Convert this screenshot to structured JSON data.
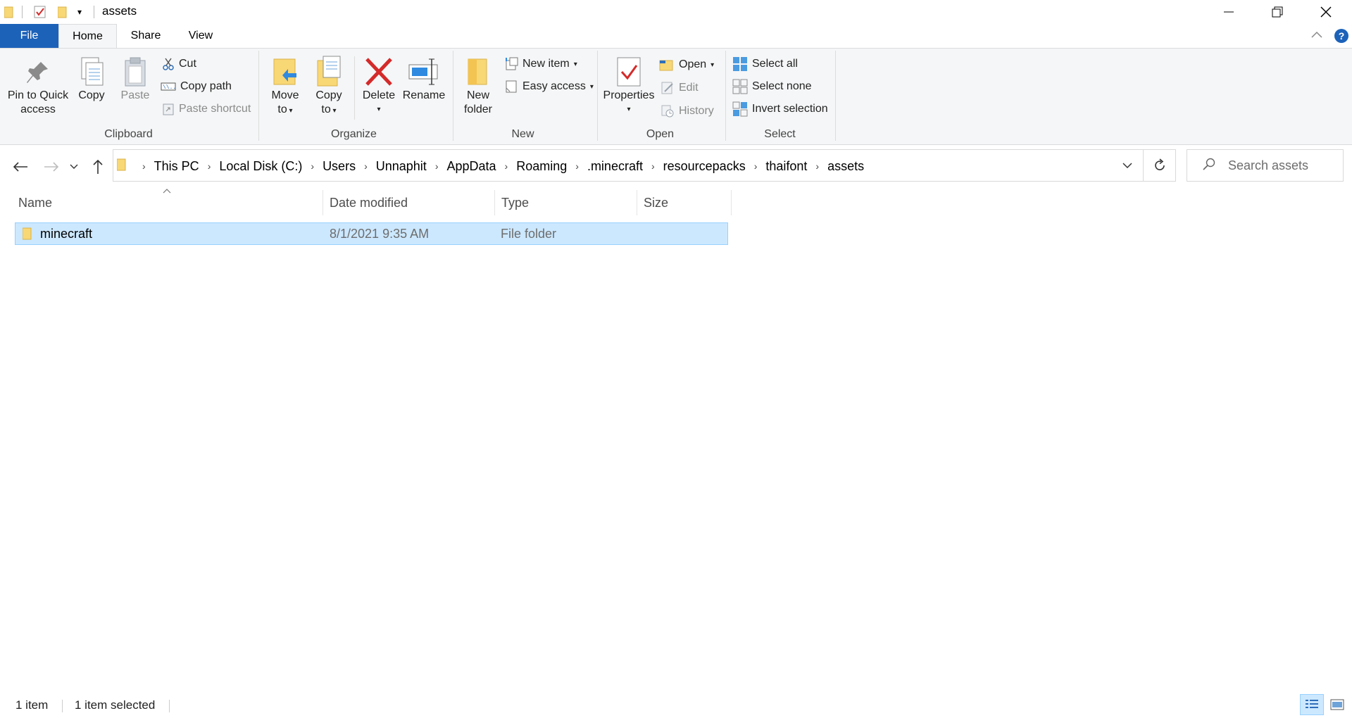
{
  "window": {
    "title": "assets",
    "controls": {
      "minimize": "minimize-icon",
      "restore": "restore-icon",
      "close": "close-icon"
    }
  },
  "ribbon_tabs": [
    "File",
    "Home",
    "Share",
    "View"
  ],
  "ribbon": {
    "clipboard": {
      "label": "Clipboard",
      "pin": "Pin to Quick access",
      "pin_line1": "Pin to Quick",
      "pin_line2": "access",
      "copy": "Copy",
      "paste": "Paste",
      "cut": "Cut",
      "copy_path": "Copy path",
      "paste_shortcut": "Paste shortcut"
    },
    "organize": {
      "label": "Organize",
      "move_to_1": "Move",
      "move_to_2": "to",
      "copy_to_1": "Copy",
      "copy_to_2": "to",
      "delete": "Delete",
      "rename": "Rename"
    },
    "new": {
      "label": "New",
      "new_folder_1": "New",
      "new_folder_2": "folder",
      "new_item": "New item",
      "easy_access": "Easy access"
    },
    "open": {
      "label": "Open",
      "properties": "Properties",
      "open": "Open",
      "edit": "Edit",
      "history": "History"
    },
    "select": {
      "label": "Select",
      "select_all": "Select all",
      "select_none": "Select none",
      "invert": "Invert selection"
    }
  },
  "address": {
    "crumbs": [
      "This PC",
      "Local Disk (C:)",
      "Users",
      "Unnaphit",
      "AppData",
      "Roaming",
      ".minecraft",
      "resourcepacks",
      "thaifont",
      "assets"
    ]
  },
  "search": {
    "placeholder": "Search assets"
  },
  "columns": {
    "name": "Name",
    "date": "Date modified",
    "type": "Type",
    "size": "Size"
  },
  "files": [
    {
      "name": "minecraft",
      "date": "8/1/2021 9:35 AM",
      "type": "File folder",
      "size": "",
      "selected": true
    }
  ],
  "status": {
    "count": "1 item",
    "selected": "1 item selected"
  },
  "colors": {
    "accent": "#1c62b9",
    "selection": "#cce8ff",
    "folder": "#f8d775",
    "delete": "#d42a2a"
  }
}
